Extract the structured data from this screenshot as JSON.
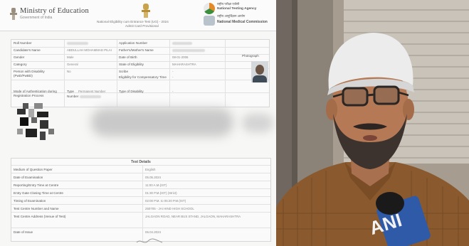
{
  "admit_card": {
    "header": {
      "ministry": "Ministry of Education",
      "ministry_sub": "Government of India",
      "exam_line1": "National Eligibility cum Entrance Test (UG) - 2024",
      "exam_line2": "Admit Card Provisional",
      "nta_hindi": "राष्ट्रीय परीक्षा एजेंसी",
      "nta_english": "National Testing Agency",
      "nmc_hindi": "राष्ट्रीय आयुर्विज्ञान आयोग",
      "nmc_english": "National Medical Commission"
    },
    "candidate": {
      "roll_label": "Roll Number",
      "application_label": "Application Number",
      "name_label": "Candidate's Name",
      "name_value": "ABDULLAH MOHAMMAD PILAI",
      "father_label": "Father's/Mother's Name",
      "gender_label": "Gender",
      "gender_value": "Male",
      "dob_label": "Date of Birth",
      "dob_value": "08-01-2006",
      "category_label": "Category",
      "category_value": "General",
      "state_label": "State of Eligibility",
      "state_value": "MAHARASHTRA",
      "pwd_label": "Person with Disability (PwD/PwBD)",
      "pwd_value": "No",
      "pwd_dash": "-",
      "scribe_label": "Scribe",
      "scribe_value": "-",
      "comp_time_label": "Eligibility for Compensatory Time",
      "comp_time_value": "-",
      "mode_label": "Mode of Authentication during Registration Process",
      "type_label": "Type",
      "type_value": "Permanent Number",
      "number_label": "Number",
      "disability_label": "Type of Disability",
      "disability_value": "-",
      "photo_label": "Photograph"
    },
    "test_details": {
      "title": "Test Details",
      "rows": [
        {
          "label": "Medium of Question Paper",
          "value": "English"
        },
        {
          "label": "Date of Examination",
          "value": "05.05.2024"
        },
        {
          "label": "Reporting/Entry Time at Centre",
          "value": "11:00 A.M.(IST)"
        },
        {
          "label": "Entry Gate Closing Time at Centre",
          "value": "01:30 P.M.(IST) (Strict)"
        },
        {
          "label": "Timing of Examination",
          "value": "02:00 P.M. to 05:20 P.M.(IST)"
        },
        {
          "label": "Test Centre Number and Name",
          "value": "250705 - JAI HIND HIGH SCHOOL"
        },
        {
          "label": "Test Centre Address (Venue of Test)",
          "value": "JALGAON ROAD, NEAR BUS STAND, JALGAON, MAHARASHTRA"
        },
        {
          "label": "Date of Issue",
          "value": "06.04.2024"
        }
      ]
    }
  },
  "interview": {
    "watermark": "ANI"
  },
  "colors": {
    "nta_orange": "#e48a2a",
    "nta_green": "#3b8e3b",
    "ani_blue": "#2f5aa8",
    "cap": "#ececec",
    "shirt": "#8a5a2e"
  }
}
